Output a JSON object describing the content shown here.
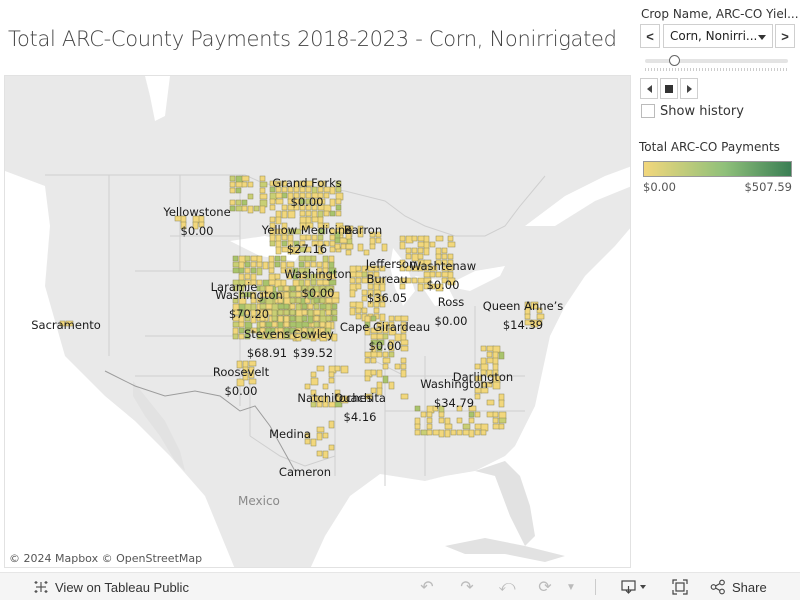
{
  "title": "Total ARC-County Payments 2018-2023 - Corn, Nonirrigated",
  "filter": {
    "label": "Crop Name, ARC-CO Yiel...",
    "selected_value": "Corn, Nonirri...",
    "prev_label": "<",
    "next_label": ">",
    "slider_position_fraction": 0.2,
    "show_history_label": "Show history",
    "show_history_checked": false
  },
  "legend": {
    "title": "Total ARC-CO Payments",
    "min_label": "$0.00",
    "max_label": "$507.59",
    "color_low": "#f2d77c",
    "color_mid": "#8fc07a",
    "color_high": "#3a7e54"
  },
  "map": {
    "country_label": "Mexico",
    "attribution": "© 2024 Mapbox  © OpenStreetMap",
    "county_labels": [
      {
        "name": "Grand Forks",
        "value": "$0.00"
      },
      {
        "name": "Yellowstone",
        "value": "$0.00"
      },
      {
        "name": "Yellow Medicine",
        "value": "$27.16"
      },
      {
        "name": "Barron",
        "value": ""
      },
      {
        "name": "Washington",
        "value": "$0.00"
      },
      {
        "name": "Jefferson",
        "value": ""
      },
      {
        "name": "Washtenaw",
        "value": "$0.00"
      },
      {
        "name": "Bureau",
        "value": "$36.05"
      },
      {
        "name": "Laramie",
        "value": ""
      },
      {
        "name": "Washington",
        "value": "$70.20"
      },
      {
        "name": "Ross",
        "value": "$0.00"
      },
      {
        "name": "Queen Anne’s",
        "value": "$14.39"
      },
      {
        "name": "Sacramento",
        "value": ""
      },
      {
        "name": "Stevens",
        "value": "$68.91"
      },
      {
        "name": "Cowley",
        "value": "$39.52"
      },
      {
        "name": "Cape Girardeau",
        "value": "$0.00"
      },
      {
        "name": "Roosevelt",
        "value": "$0.00"
      },
      {
        "name": "Darlington",
        "value": ""
      },
      {
        "name": "Washington",
        "value": "$34.79"
      },
      {
        "name": "Natchitoches",
        "value": ""
      },
      {
        "name": "Ouachita",
        "value": "$4.16"
      },
      {
        "name": "Medina",
        "value": ""
      },
      {
        "name": "Cameron",
        "value": ""
      }
    ]
  },
  "footer": {
    "view_on_label": "View on Tableau Public",
    "share_label": "Share"
  }
}
